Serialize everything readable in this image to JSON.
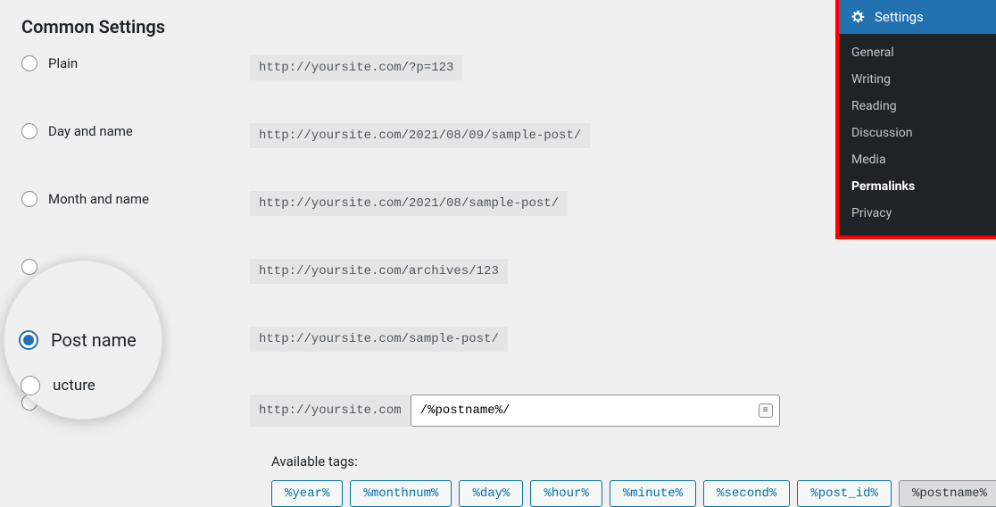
{
  "title": "Common Settings",
  "options": [
    {
      "key": "plain",
      "label": "Plain",
      "example": "http://yoursite.com/?p=123",
      "selected": false
    },
    {
      "key": "day_name",
      "label": "Day and name",
      "example": "http://yoursite.com/2021/08/09/sample-post/",
      "selected": false
    },
    {
      "key": "month_name",
      "label": "Month and name",
      "example": "http://yoursite.com/2021/08/sample-post/",
      "selected": false
    },
    {
      "key": "numeric",
      "label": "",
      "example": "http://yoursite.com/archives/123",
      "selected": false
    },
    {
      "key": "post_name",
      "label": "Post name",
      "example": "http://yoursite.com/sample-post/",
      "selected": true
    },
    {
      "key": "custom",
      "label": "ucture",
      "example": "",
      "selected": false
    }
  ],
  "custom": {
    "prefix": "http://yoursite.com",
    "value": "/%postname%/"
  },
  "available_tags_label": "Available tags:",
  "tags": [
    {
      "text": "%year%",
      "active": false
    },
    {
      "text": "%monthnum%",
      "active": false
    },
    {
      "text": "%day%",
      "active": false
    },
    {
      "text": "%hour%",
      "active": false
    },
    {
      "text": "%minute%",
      "active": false
    },
    {
      "text": "%second%",
      "active": false
    },
    {
      "text": "%post_id%",
      "active": false
    },
    {
      "text": "%postname%",
      "active": true
    }
  ],
  "sidebar": {
    "title": "Settings",
    "items": [
      {
        "label": "General",
        "current": false
      },
      {
        "label": "Writing",
        "current": false
      },
      {
        "label": "Reading",
        "current": false
      },
      {
        "label": "Discussion",
        "current": false
      },
      {
        "label": "Media",
        "current": false
      },
      {
        "label": "Permalinks",
        "current": true
      },
      {
        "label": "Privacy",
        "current": false
      }
    ]
  },
  "magnifier": {
    "main_label": "Post name",
    "partial_label": "ucture"
  }
}
